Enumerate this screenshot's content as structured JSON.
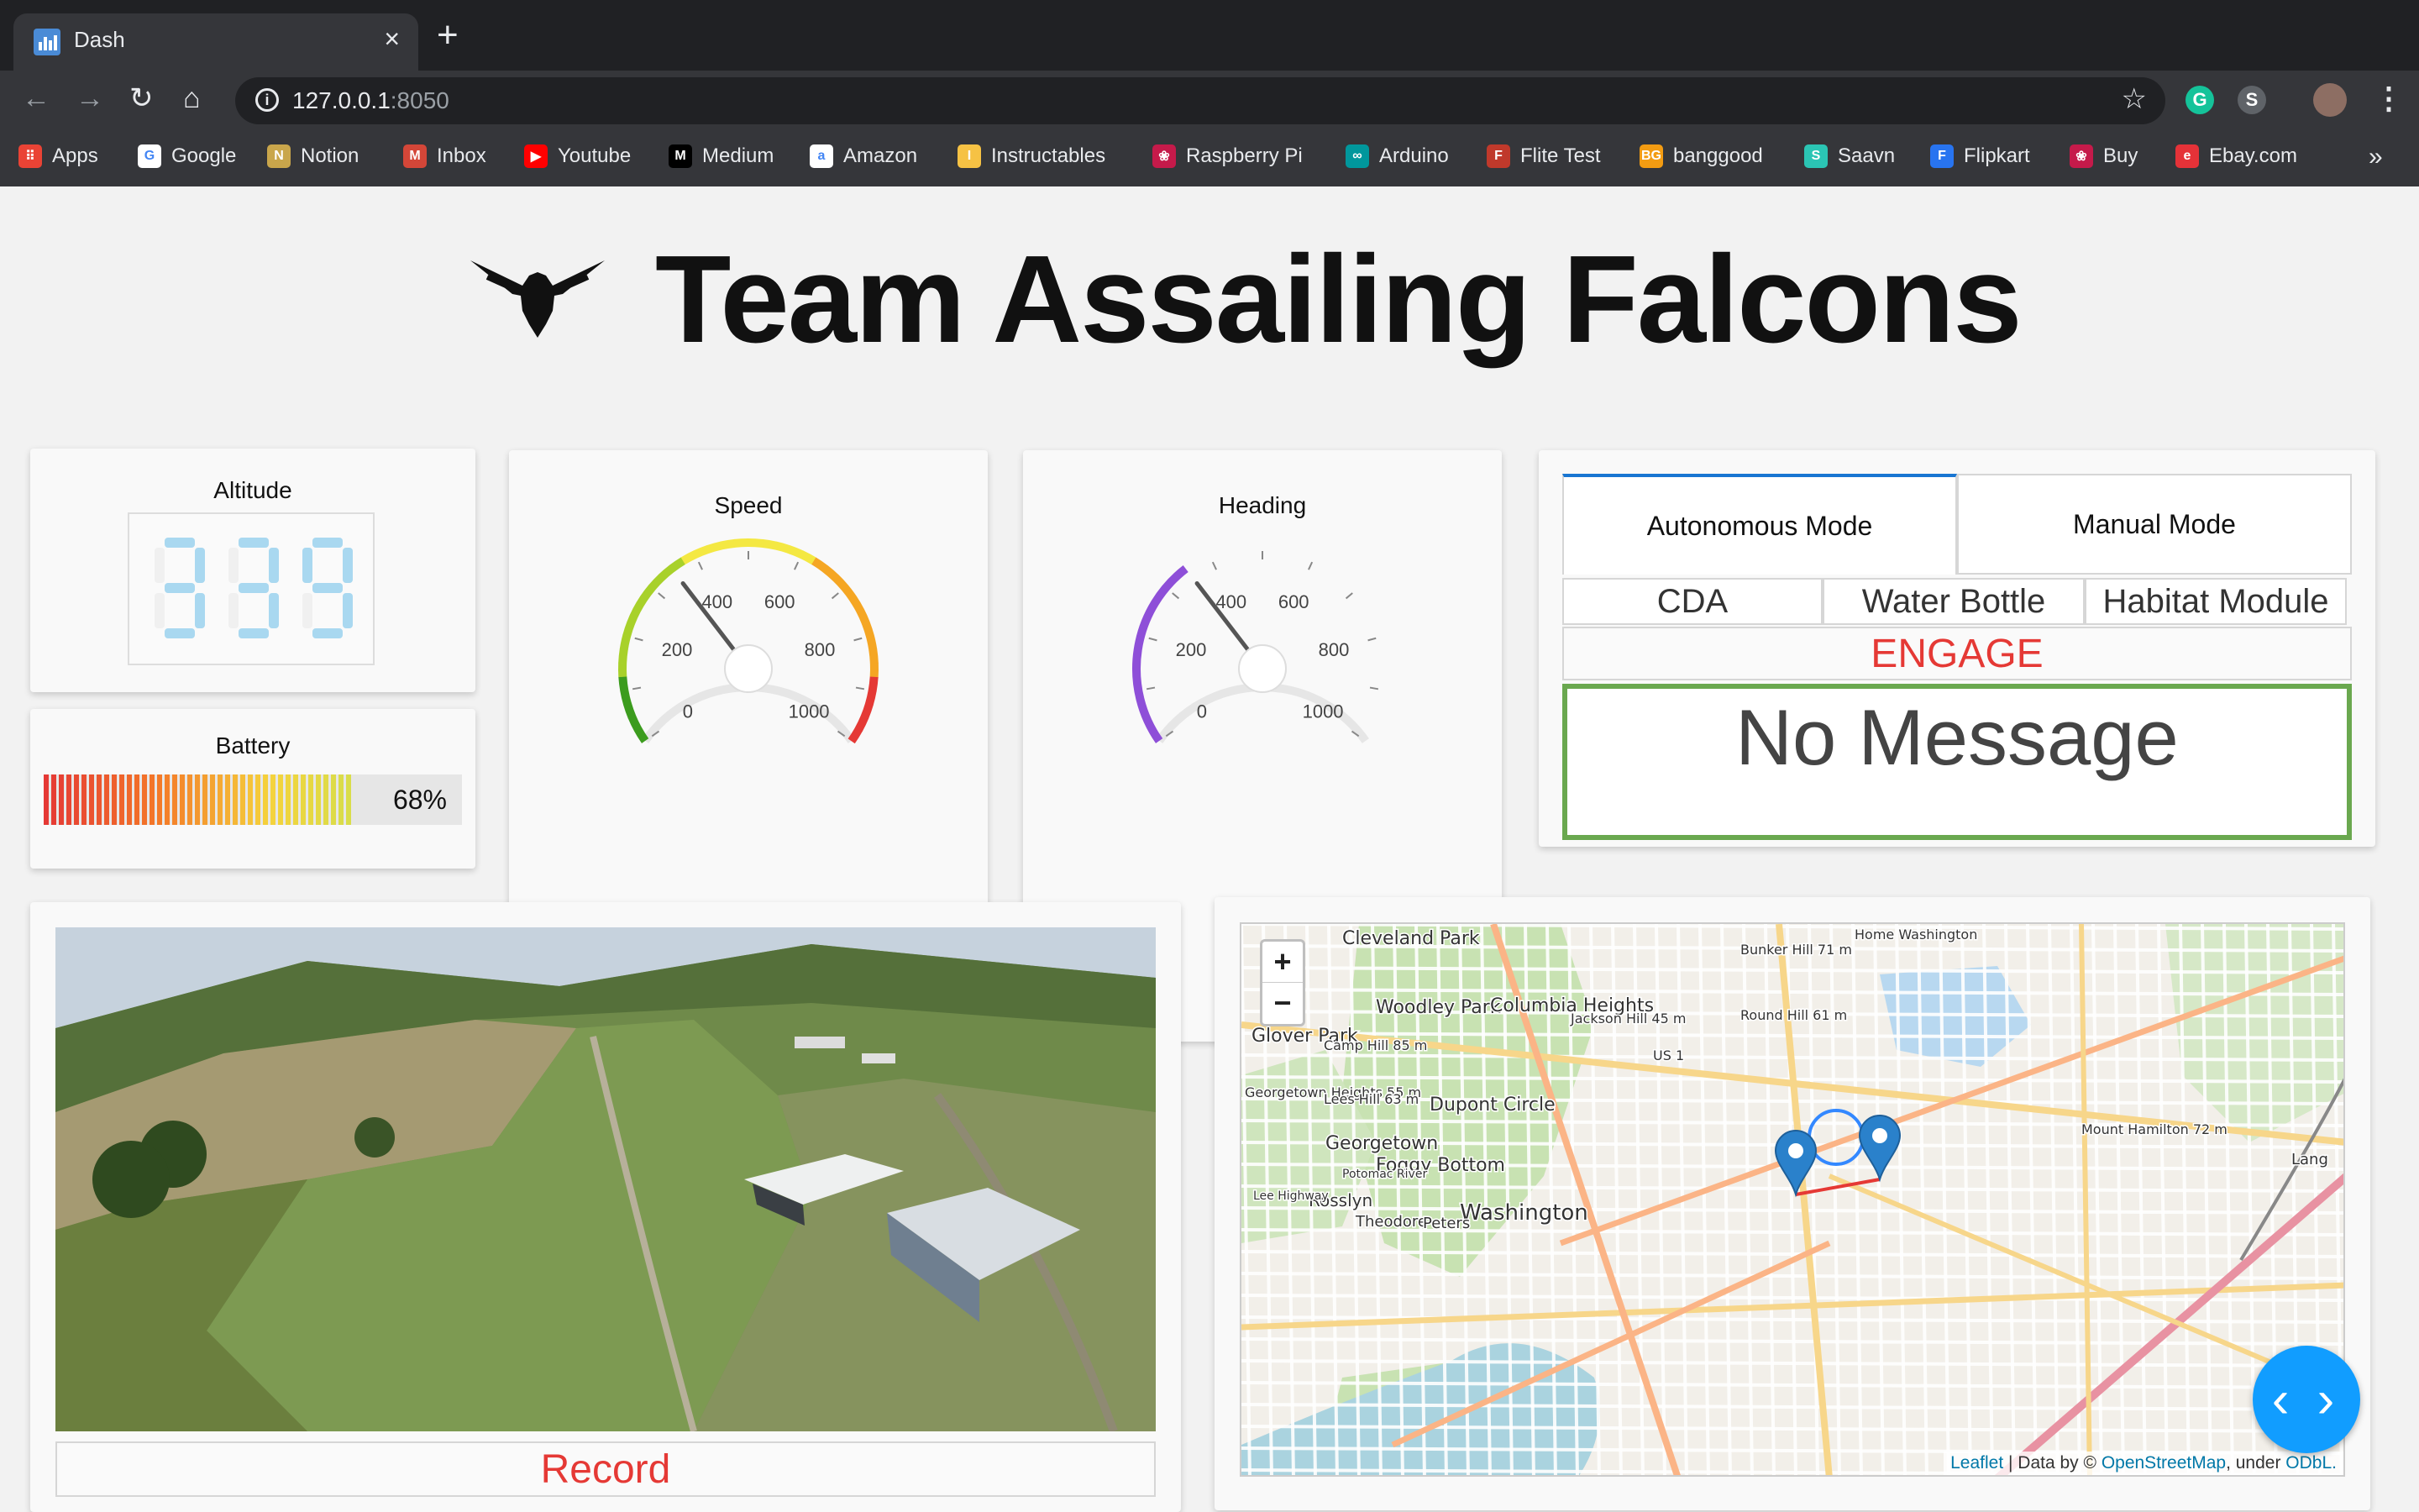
{
  "browser": {
    "tab_title": "Dash",
    "close_glyph": "×",
    "new_tab_glyph": "+",
    "url_host": "127.0.0.1",
    "url_port": ":8050",
    "bookmarks": [
      {
        "label": "Apps",
        "icon": "apps-grid-icon",
        "color": "#ea4335",
        "glyph": "⠿"
      },
      {
        "label": "Google",
        "icon": "google-icon",
        "color": "#ffffff",
        "glyph": "G"
      },
      {
        "label": "Notion",
        "icon": "notion-icon",
        "color": "#c9a64b",
        "glyph": "N"
      },
      {
        "label": "Inbox",
        "icon": "inbox-mail-icon",
        "color": "#d44638",
        "glyph": "M"
      },
      {
        "label": "Youtube",
        "icon": "youtube-icon",
        "color": "#ff0000",
        "glyph": "▶"
      },
      {
        "label": "Medium",
        "icon": "medium-icon",
        "color": "#000000",
        "glyph": "M"
      },
      {
        "label": "Amazon",
        "icon": "amazon-icon",
        "color": "#ffffff",
        "glyph": "a"
      },
      {
        "label": "Instructables",
        "icon": "instructables-icon",
        "color": "#f6c244",
        "glyph": "I"
      },
      {
        "label": "Raspberry Pi",
        "icon": "raspberry-pi-icon",
        "color": "#c51a4a",
        "glyph": "❀"
      },
      {
        "label": "Arduino",
        "icon": "arduino-icon",
        "color": "#00979c",
        "glyph": "∞"
      },
      {
        "label": "Flite Test",
        "icon": "flite-test-icon",
        "color": "#c0392b",
        "glyph": "F"
      },
      {
        "label": "banggood",
        "icon": "banggood-icon",
        "color": "#f39c12",
        "glyph": "BG"
      },
      {
        "label": "Saavn",
        "icon": "saavn-icon",
        "color": "#2bc5b4",
        "glyph": "S"
      },
      {
        "label": "Flipkart",
        "icon": "flipkart-icon",
        "color": "#2874f0",
        "glyph": "F"
      },
      {
        "label": "Buy",
        "icon": "raspberry-buy-icon",
        "color": "#c51a4a",
        "glyph": "❀"
      },
      {
        "label": "Ebay.com",
        "icon": "ebay-icon",
        "color": "#e53238",
        "glyph": "e"
      }
    ],
    "more_glyph": "»"
  },
  "header": {
    "title": "Team Assailing Falcons"
  },
  "altitude": {
    "label": "Altitude",
    "value": "339"
  },
  "battery": {
    "label": "Battery",
    "percent": 68,
    "display": "68%"
  },
  "speed": {
    "label": "Speed",
    "value": 350,
    "min": 0,
    "max": 1000,
    "ticks": [
      "0",
      "200",
      "400",
      "600",
      "800",
      "1000"
    ],
    "gradient_colors": [
      "#3c9c1e",
      "#a8d12a",
      "#f4e842",
      "#f5a623",
      "#e53935"
    ]
  },
  "heading": {
    "label": "Heading",
    "value": 350,
    "min": 0,
    "max": 1000,
    "ticks": [
      "0",
      "200",
      "400",
      "600",
      "800",
      "1000"
    ],
    "progress_color": "#8e4fd8"
  },
  "mode_tabs": {
    "autonomous": "Autonomous Mode",
    "manual": "Manual Mode",
    "sub_tabs": [
      "CDA",
      "Water Bottle",
      "Habitat Module"
    ],
    "engage": "ENGAGE",
    "message": "No Message",
    "accent_color": "#1976d2",
    "message_border_color": "#6aa84f",
    "engage_color": "#e53935"
  },
  "video": {
    "record_label": "Record"
  },
  "map": {
    "zoom_in": "+",
    "zoom_out": "−",
    "places": [
      "Cleveland Park",
      "Home Washington",
      "Bunker Hill 71 m",
      "Woodley Park",
      "Columbia Heights",
      "Jackson Hill 45 m",
      "Glover Park",
      "Camp Hill 85 m",
      "Round Hill 61 m",
      "US 1",
      "Georgetown Heights 55 m",
      "Lees Hill 63 m",
      "Dupont Circle",
      "Mount Hamilton 72 m",
      "Georgetown",
      "Foggy Bottom",
      "Rosslyn",
      "Washington",
      "Lee Highway",
      "Theodore",
      "Peters",
      "Lang",
      "Potomac River"
    ],
    "attribution_leaflet": "Leaflet",
    "attribution_mid": " | Data by © ",
    "attribution_osm": "OpenStreetMap",
    "attribution_tail": ", under ",
    "attribution_odbl": "ODbL."
  },
  "debug_button": {
    "glyph": "‹ ›"
  }
}
